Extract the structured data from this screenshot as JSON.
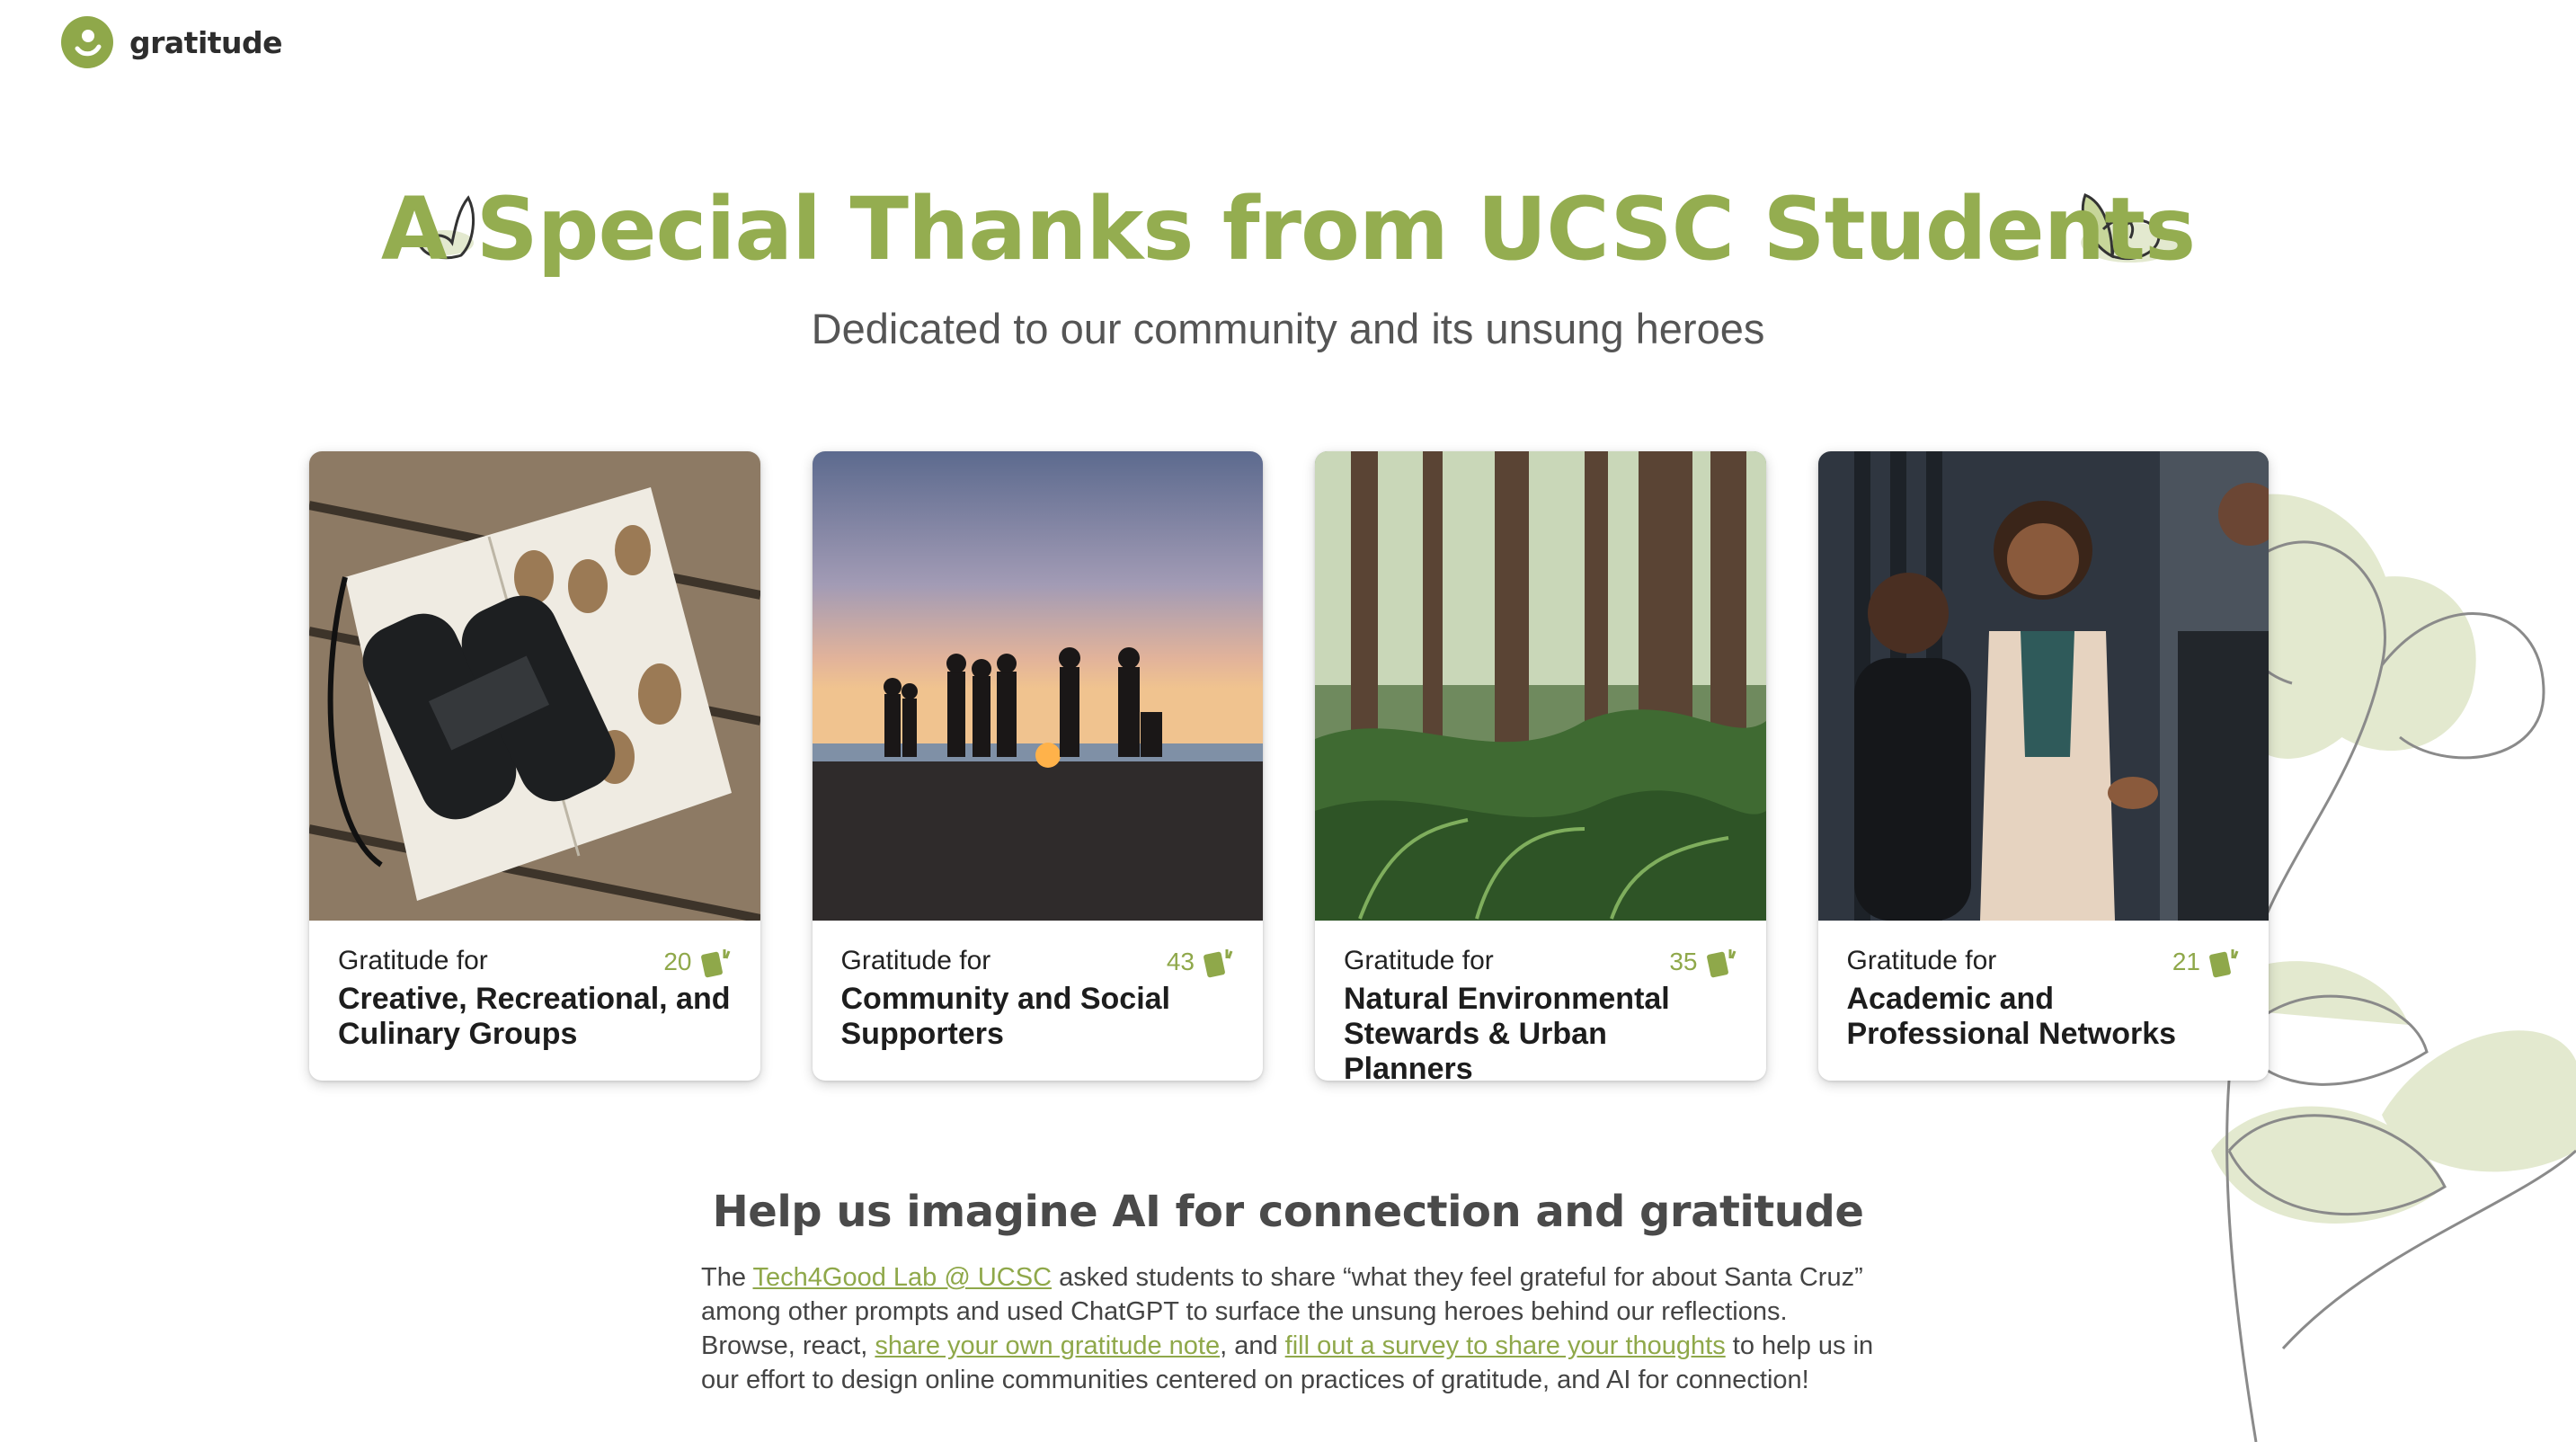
{
  "header": {
    "brand": "gratitude"
  },
  "hero": {
    "title": "A Special Thanks from UCSC Students",
    "subtitle": "Dedicated to our community and its unsung heroes"
  },
  "cards": [
    {
      "pre": "Gratitude for",
      "title": "Creative, Recreational, and Culinary Groups",
      "count": "20"
    },
    {
      "pre": "Gratitude for",
      "title": "Community and Social Supporters",
      "count": "43"
    },
    {
      "pre": "Gratitude for",
      "title": "Natural Environmental Stewards & Urban Planners",
      "count": "35"
    },
    {
      "pre": "Gratitude for",
      "title": "Academic and Professional Networks",
      "count": "21"
    }
  ],
  "help": {
    "title": "Help us imagine AI for connection and gratitude",
    "p1": "The ",
    "link1": "Tech4Good Lab @ UCSC",
    "p2": " asked students to share “what they feel grateful for about Santa Cruz” among other prompts and used ChatGPT to surface the unsung heroes behind our reflections. Browse, react, ",
    "link2": "share your own gratitude note",
    "p3": ", and ",
    "link3": "fill out a survey to share your thoughts",
    "p4": " to help us in our effort to design online communities centered on practices of gratitude, and AI for connection!"
  },
  "colors": {
    "accent": "#94ad50",
    "accent_dark": "#8fa84a",
    "text": "#222222"
  },
  "icons": {
    "logo": "gratitude-logo-icon",
    "note": "note-card-icon",
    "decor": "heart-sprout-icon"
  }
}
